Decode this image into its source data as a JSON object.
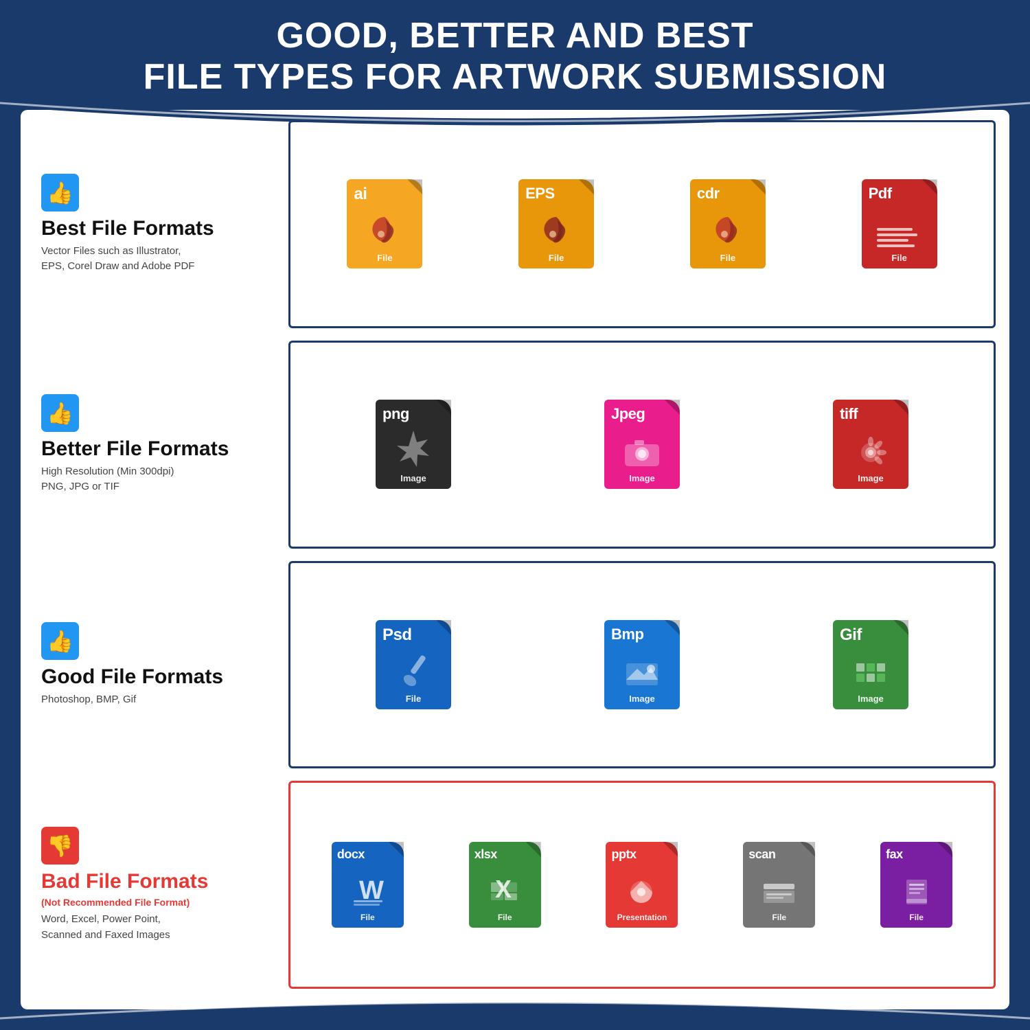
{
  "header": {
    "line1": "GOOD, BETTER AND BEST",
    "line2": "FILE TYPES FOR ARTWORK SUBMISSION"
  },
  "rows": [
    {
      "id": "best",
      "thumbs": "up",
      "title": "Best File Formats",
      "subtitle": "",
      "description": "Vector Files such as Illustrator,\nEPS, Corel Draw and Adobe PDF",
      "border_color": "blue",
      "files": [
        {
          "ext": "ai",
          "label": "File",
          "color": "orange",
          "icon": "pen"
        },
        {
          "ext": "EPS",
          "label": "File",
          "color": "orange-dark",
          "icon": "pen"
        },
        {
          "ext": "cdr",
          "label": "File",
          "color": "orange-dark",
          "icon": "pen"
        },
        {
          "ext": "Pdf",
          "label": "File",
          "color": "red-dark",
          "icon": "pdf"
        }
      ]
    },
    {
      "id": "better",
      "thumbs": "up",
      "title": "Better File Formats",
      "subtitle": "",
      "description": "High Resolution (Min 300dpi)\nPNG, JPG or TIF",
      "border_color": "blue",
      "files": [
        {
          "ext": "png",
          "label": "Image",
          "color": "black",
          "icon": "star"
        },
        {
          "ext": "Jpeg",
          "label": "Image",
          "color": "pink",
          "icon": "camera"
        },
        {
          "ext": "tiff",
          "label": "Image",
          "color": "red-tiff",
          "icon": "flower"
        }
      ]
    },
    {
      "id": "good",
      "thumbs": "up",
      "title": "Good File Formats",
      "subtitle": "",
      "description": "Photoshop, BMP, Gif",
      "border_color": "blue",
      "files": [
        {
          "ext": "Psd",
          "label": "File",
          "color": "blue-dark",
          "icon": "brush"
        },
        {
          "ext": "Bmp",
          "label": "Image",
          "color": "blue-mid",
          "icon": "landscape"
        },
        {
          "ext": "Gif",
          "label": "Image",
          "color": "green-dark",
          "icon": "grid"
        }
      ]
    },
    {
      "id": "bad",
      "thumbs": "down",
      "title": "Bad File Formats",
      "subtitle": "(Not Recommended File Format)",
      "description": "Word, Excel, Power Point,\nScanned and Faxed Images",
      "border_color": "red",
      "files": [
        {
          "ext": "docx",
          "label": "File",
          "color": "blue-word",
          "icon": "word"
        },
        {
          "ext": "xlsx",
          "label": "File",
          "color": "green-excel",
          "icon": "excel"
        },
        {
          "ext": "pptx",
          "label": "Presentation",
          "color": "red-ppt",
          "icon": "ppt"
        },
        {
          "ext": "scan",
          "label": "File",
          "color": "gray-scan",
          "icon": "scan"
        },
        {
          "ext": "fax",
          "label": "File",
          "color": "purple-fax",
          "icon": "fax"
        }
      ]
    }
  ]
}
